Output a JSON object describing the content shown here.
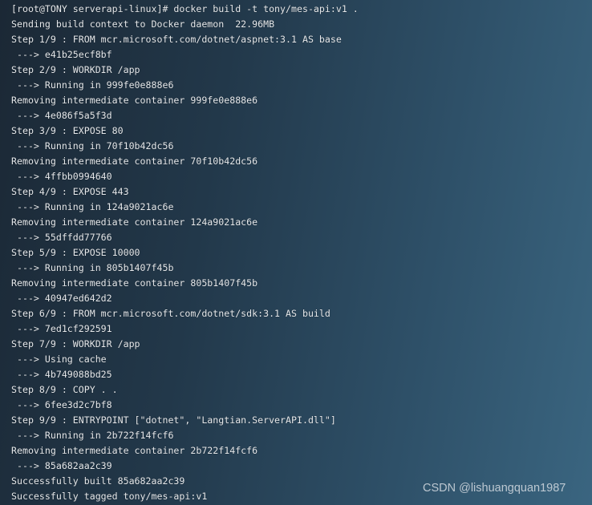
{
  "terminal": {
    "lines": [
      "[root@TONY serverapi-linux]# docker build -t tony/mes-api:v1 .",
      "Sending build context to Docker daemon  22.96MB",
      "Step 1/9 : FROM mcr.microsoft.com/dotnet/aspnet:3.1 AS base",
      " ---> e41b25ecf8bf",
      "Step 2/9 : WORKDIR /app",
      " ---> Running in 999fe0e888e6",
      "Removing intermediate container 999fe0e888e6",
      " ---> 4e086f5a5f3d",
      "Step 3/9 : EXPOSE 80",
      " ---> Running in 70f10b42dc56",
      "Removing intermediate container 70f10b42dc56",
      " ---> 4ffbb0994640",
      "Step 4/9 : EXPOSE 443",
      " ---> Running in 124a9021ac6e",
      "Removing intermediate container 124a9021ac6e",
      " ---> 55dffdd77766",
      "Step 5/9 : EXPOSE 10000",
      " ---> Running in 805b1407f45b",
      "Removing intermediate container 805b1407f45b",
      " ---> 40947ed642d2",
      "Step 6/9 : FROM mcr.microsoft.com/dotnet/sdk:3.1 AS build",
      " ---> 7ed1cf292591",
      "Step 7/9 : WORKDIR /app",
      " ---> Using cache",
      " ---> 4b749088bd25",
      "Step 8/9 : COPY . .",
      " ---> 6fee3d2c7bf8",
      "Step 9/9 : ENTRYPOINT [\"dotnet\", \"Langtian.ServerAPI.dll\"]",
      " ---> Running in 2b722f14fcf6",
      "Removing intermediate container 2b722f14fcf6",
      " ---> 85a682aa2c39",
      "Successfully built 85a682aa2c39",
      "Successfully tagged tony/mes-api:v1"
    ]
  },
  "watermark": "CSDN @lishuangquan1987",
  "colors": {
    "text": "#e6e9ec",
    "background_dark": "#1b2835",
    "background_light": "#3a6580"
  }
}
